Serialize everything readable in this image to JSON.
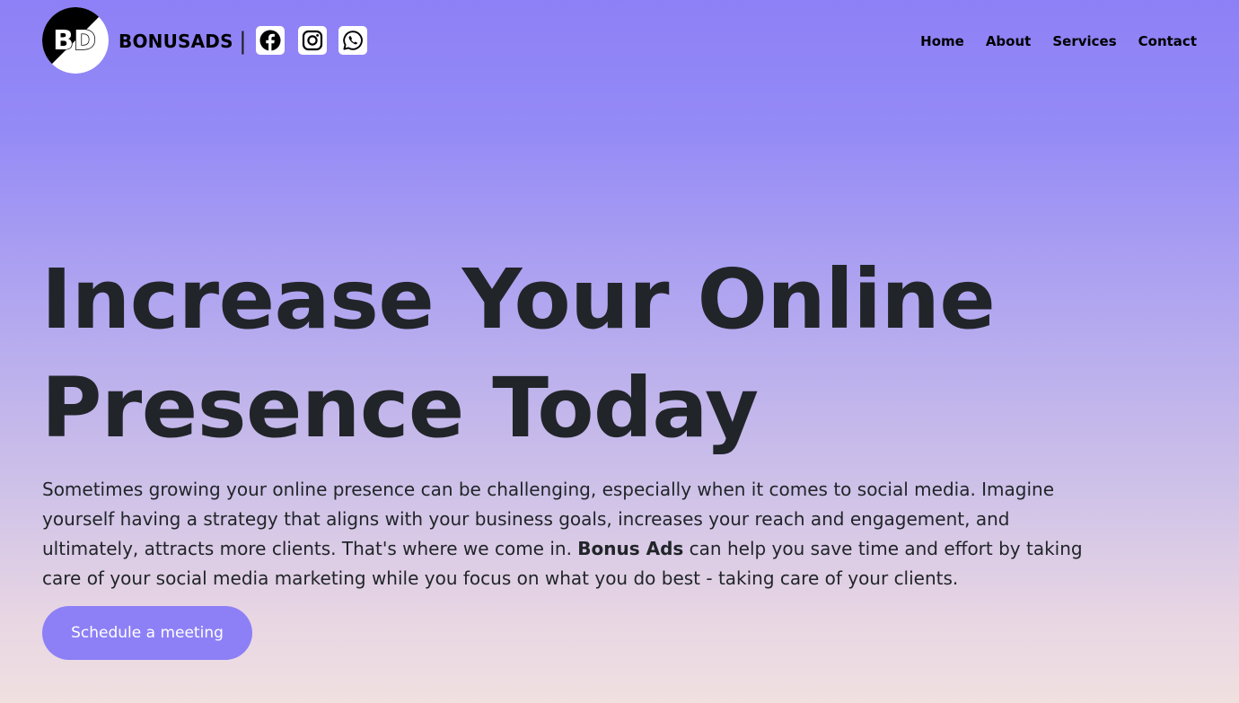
{
  "brand": {
    "logo_text": "BD",
    "name": "BONUSADS",
    "divider": "|"
  },
  "social": [
    {
      "icon": "facebook-icon"
    },
    {
      "icon": "instagram-icon"
    },
    {
      "icon": "whatsapp-icon"
    }
  ],
  "nav": {
    "home": "Home",
    "about": "About",
    "services": "Services",
    "contact": "Contact"
  },
  "hero": {
    "title_line1": "Increase Your Online",
    "title_line2": "Presence Today",
    "text_part1": "Sometimes growing your online presence can be challenging, especially when it comes to social media. Imagine yourself having a strategy that aligns with your business goals, increases your reach and engagement, and ultimately, attracts more clients. That's where we come in.",
    "text_bold": "Bonus Ads",
    "text_part2": "can help you save time and effort by taking care of your social media marketing while you focus on what you do best - taking care of your clients.",
    "cta_label": "Schedule a meeting"
  },
  "colors": {
    "accent": "#8d80f6",
    "text": "#212529",
    "gradient_top": "#8d80f6",
    "gradient_bottom": "#f0e0e0"
  }
}
